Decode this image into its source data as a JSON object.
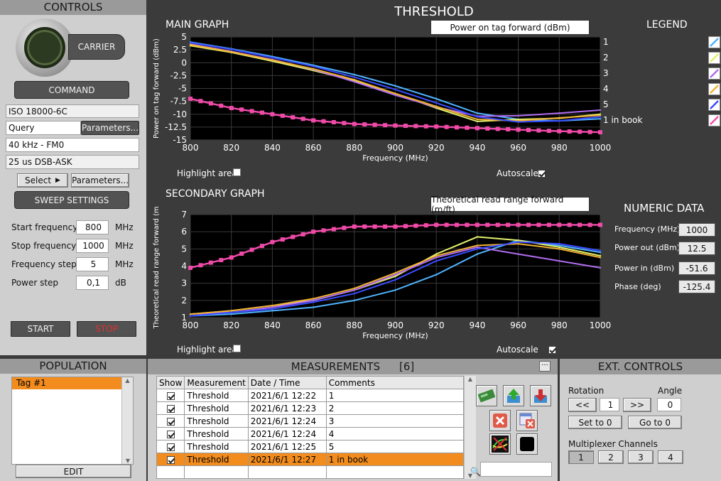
{
  "controls": {
    "title": "CONTROLS",
    "carrier_label": "CARRIER",
    "command_label": "COMMAND",
    "protocol": "ISO 18000-6C",
    "query": "Query",
    "parameters_label": "Parameters...",
    "link": "40 kHz - FM0",
    "modulation": "25 us DSB-ASK",
    "select_label": "Select",
    "parameters2_label": "Parameters...",
    "sweep_label": "SWEEP SETTINGS",
    "start_freq_label": "Start frequency",
    "start_freq": "800",
    "start_unit": "MHz",
    "stop_freq_label": "Stop frequency",
    "stop_freq": "1000",
    "stop_unit": "MHz",
    "step_label": "Frequency step",
    "step": "5",
    "step_unit": "MHz",
    "power_step_label": "Power step",
    "power_step": "0,1",
    "power_unit": "dB",
    "start_label": "START",
    "stop_label": "STOP"
  },
  "threshold": {
    "title": "THRESHOLD",
    "main_graph": "MAIN GRAPH",
    "main_selector": "Power on tag forward (dBm)",
    "legend_title": "LEGEND",
    "highlight_label": "Highlight area",
    "autoscale_label": "Autoscale",
    "secondary_graph": "SECONDARY GRAPH",
    "secondary_selector": "Theoretical read range forward (m/ft)",
    "numeric_title": "NUMERIC DATA",
    "freq_label": "Frequency (MHz)",
    "freq_value": "1000",
    "pout_label": "Power out (dBm)",
    "pout_value": "12.5",
    "pin_label": "Power in (dBm)",
    "pin_value": "-51.6",
    "phase_label": "Phase (deg)",
    "phase_value": "-125.4",
    "legend": [
      "1",
      "2",
      "3",
      "4",
      "5",
      "1 in book"
    ]
  },
  "colors": {
    "s1": "#4fb3ff",
    "s2": "#e3f06a",
    "s3": "#b06cf0",
    "s4": "#f2b233",
    "s5": "#3a4cff",
    "s6": "#f04aa8"
  },
  "chart_data": [
    {
      "type": "line",
      "title": "",
      "xlabel": "Frequency (MHz)",
      "ylabel": "Power on tag forward (dBm)",
      "xlim": [
        800,
        1000
      ],
      "ylim": [
        -15,
        5
      ],
      "xticks": [
        "800",
        "820",
        "840",
        "860",
        "880",
        "900",
        "920",
        "940",
        "960",
        "980",
        "1000"
      ],
      "yticks": [
        "5",
        "2.5",
        "0",
        "-2.5",
        "-5",
        "-7.5",
        "-10",
        "-12.5",
        "-15"
      ],
      "x": [
        800,
        820,
        840,
        860,
        880,
        900,
        920,
        940,
        960,
        980,
        1000
      ],
      "series": [
        {
          "name": "1",
          "values": [
            4.0,
            2.7,
            1.2,
            -0.5,
            -2.3,
            -4.5,
            -7.0,
            -9.8,
            -11.0,
            -11.3,
            -10.9
          ]
        },
        {
          "name": "2",
          "values": [
            3.3,
            2.0,
            0.3,
            -1.5,
            -3.5,
            -6.0,
            -8.8,
            -11.4,
            -11.0,
            -10.8,
            -10.0
          ]
        },
        {
          "name": "3",
          "values": [
            3.6,
            2.2,
            0.6,
            -1.3,
            -3.7,
            -6.3,
            -8.6,
            -10.4,
            -10.3,
            -9.8,
            -9.2
          ]
        },
        {
          "name": "4",
          "values": [
            3.5,
            2.1,
            0.5,
            -1.2,
            -3.3,
            -6.0,
            -8.5,
            -11.0,
            -11.3,
            -10.7,
            -10.2
          ]
        },
        {
          "name": "5",
          "values": [
            3.9,
            2.6,
            1.0,
            -0.7,
            -2.8,
            -5.2,
            -7.8,
            -10.5,
            -11.5,
            -11.3,
            -10.5
          ]
        },
        {
          "name": "1 in book",
          "values": [
            -7.0,
            -8.8,
            -10.0,
            -11.2,
            -11.9,
            -12.2,
            -12.4,
            -12.7,
            -13.0,
            -13.3,
            -13.5
          ]
        }
      ]
    },
    {
      "type": "line",
      "title": "",
      "xlabel": "Frequency (MHz)",
      "ylabel": "Theoretical read range forward (m)",
      "xlim": [
        800,
        1000
      ],
      "ylim": [
        1,
        7
      ],
      "xticks": [
        "800",
        "820",
        "840",
        "860",
        "880",
        "900",
        "920",
        "940",
        "960",
        "980",
        "1000"
      ],
      "yticks": [
        "7",
        "6",
        "5",
        "4",
        "3",
        "2",
        "1"
      ],
      "x": [
        800,
        820,
        840,
        860,
        880,
        900,
        920,
        940,
        960,
        980,
        1000
      ],
      "series": [
        {
          "name": "1",
          "values": [
            1.1,
            1.2,
            1.4,
            1.6,
            2.0,
            2.6,
            3.5,
            4.7,
            5.5,
            5.2,
            4.8
          ]
        },
        {
          "name": "2",
          "values": [
            1.2,
            1.4,
            1.7,
            2.0,
            2.6,
            3.4,
            4.7,
            5.7,
            5.5,
            5.1,
            4.6
          ]
        },
        {
          "name": "3",
          "values": [
            1.2,
            1.3,
            1.6,
            2.0,
            2.6,
            3.5,
            4.5,
            5.1,
            4.7,
            4.3,
            3.9
          ]
        },
        {
          "name": "4",
          "values": [
            1.2,
            1.4,
            1.7,
            2.1,
            2.7,
            3.6,
            4.6,
            5.2,
            5.3,
            5.0,
            4.5
          ]
        },
        {
          "name": "5",
          "values": [
            1.1,
            1.3,
            1.5,
            1.9,
            2.4,
            3.2,
            4.3,
            5.0,
            5.4,
            5.3,
            4.9
          ]
        },
        {
          "name": "1 in book",
          "values": [
            3.9,
            4.5,
            5.4,
            6.0,
            6.3,
            6.3,
            6.4,
            6.4,
            6.4,
            6.4,
            6.4
          ]
        }
      ]
    }
  ],
  "population": {
    "title": "POPULATION",
    "items": [
      "Tag #1"
    ],
    "edit_label": "EDIT"
  },
  "measurements": {
    "title": "MEASUREMENTS",
    "count": "[6]",
    "menu_label": "···",
    "columns": [
      "Show",
      "Measurement",
      "Date / Time",
      "Comments"
    ],
    "rows": [
      {
        "measurement": "Threshold",
        "date": "2021/6/1 12:22",
        "comment": "1"
      },
      {
        "measurement": "Threshold",
        "date": "2021/6/1 12:23",
        "comment": "2"
      },
      {
        "measurement": "Threshold",
        "date": "2021/6/1 12:24",
        "comment": "3"
      },
      {
        "measurement": "Threshold",
        "date": "2021/6/1 12:24",
        "comment": "4"
      },
      {
        "measurement": "Threshold",
        "date": "2021/6/1 12:25",
        "comment": "5"
      },
      {
        "measurement": "Threshold",
        "date": "2021/6/1 12:27",
        "comment": "1 in book"
      }
    ]
  },
  "ext_controls": {
    "title": "EXT. CONTROLS",
    "rotation_label": "Rotation",
    "angle_label": "Angle",
    "prev_label": "<<",
    "rotation_value": "1",
    "next_label": ">>",
    "angle_value": "0",
    "set_to_zero": "Set to 0",
    "go_to_zero": "Go to 0",
    "mux_label": "Multiplexer Channels",
    "channels": [
      "1",
      "2",
      "3",
      "4"
    ]
  }
}
